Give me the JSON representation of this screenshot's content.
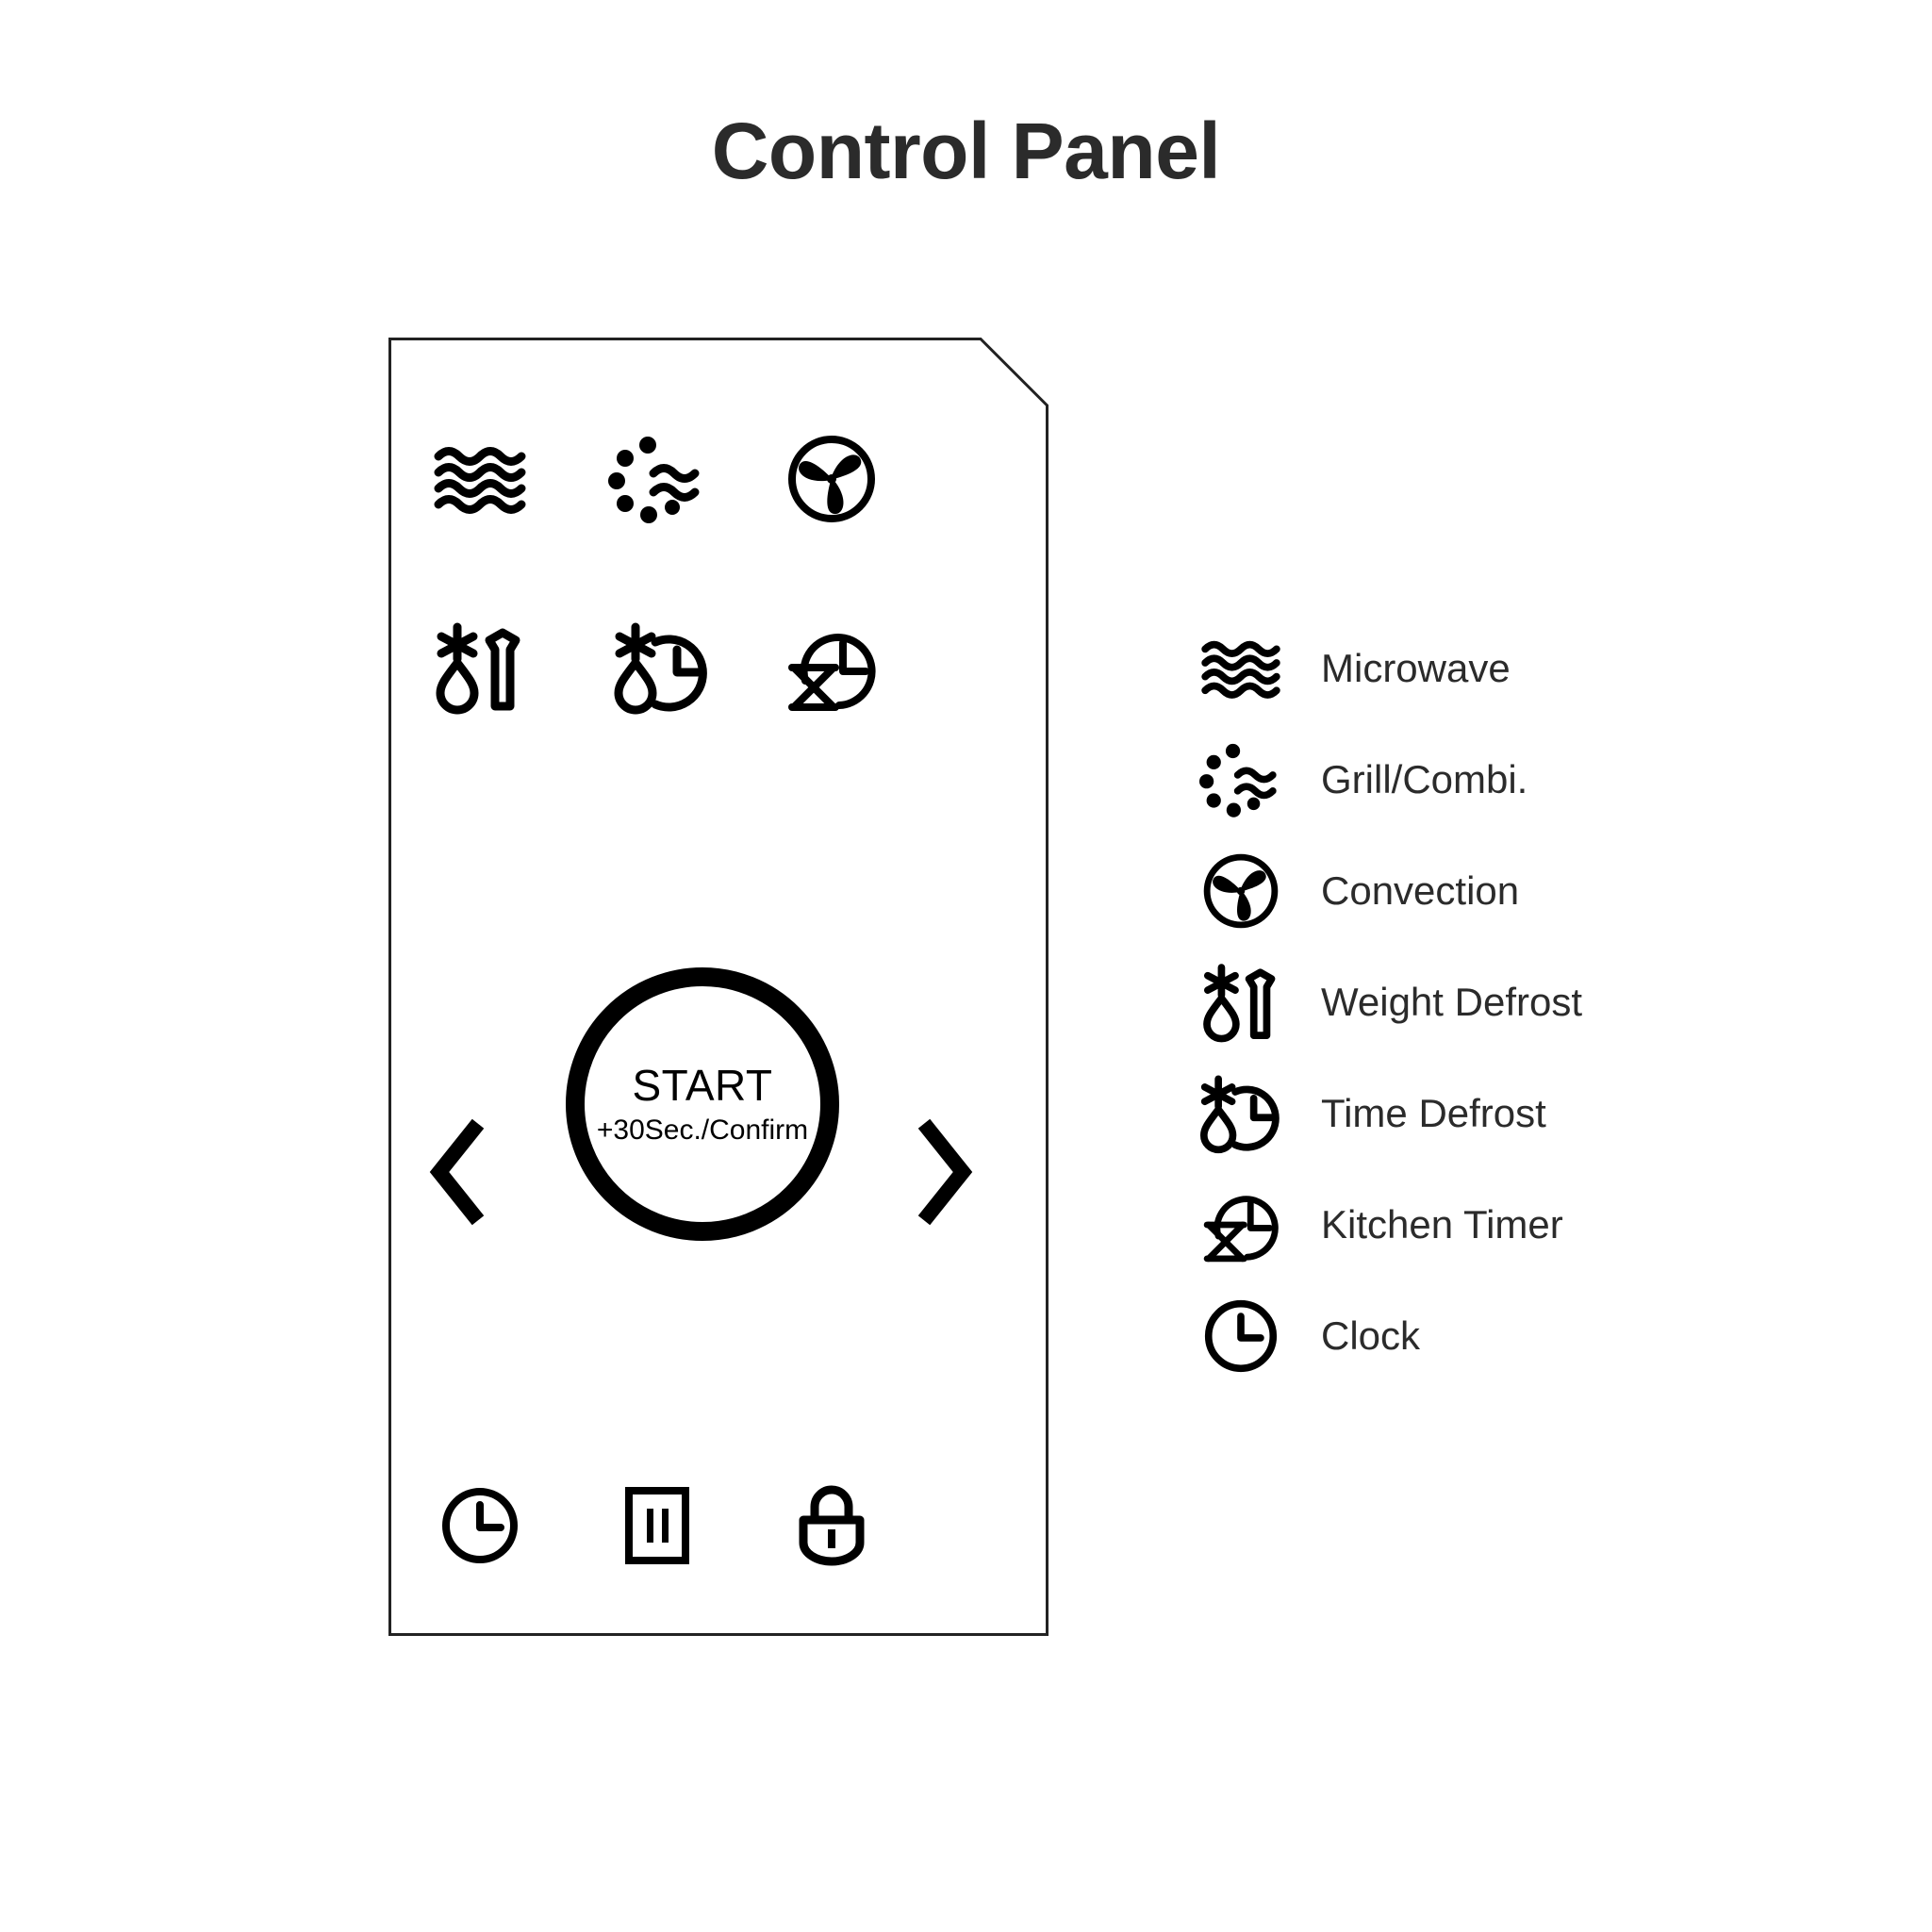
{
  "page": {
    "title": "Control Panel",
    "background_color": "#ffffff",
    "title_color": "#2b2b2b",
    "stroke_color": "#000000"
  },
  "panel": {
    "name": "microwave-control-panel",
    "outline_color": "#222222",
    "corner_cut": "top-right",
    "buttons": [
      {
        "row": 1,
        "col": 1,
        "icon": "microwave-waves-icon",
        "function": "Microwave"
      },
      {
        "row": 1,
        "col": 2,
        "icon": "grill-combi-icon",
        "function": "Grill/Combi."
      },
      {
        "row": 1,
        "col": 3,
        "icon": "convection-fan-icon",
        "function": "Convection"
      },
      {
        "row": 2,
        "col": 1,
        "icon": "weight-defrost-icon",
        "function": "Weight Defrost"
      },
      {
        "row": 2,
        "col": 2,
        "icon": "time-defrost-icon",
        "function": "Time Defrost"
      },
      {
        "row": 2,
        "col": 3,
        "icon": "kitchen-timer-icon",
        "function": "Kitchen Timer"
      }
    ],
    "bottom_buttons": [
      {
        "icon": "clock-icon",
        "function": "Clock"
      },
      {
        "icon": "pause-icon",
        "function": "Pause/Stop"
      },
      {
        "icon": "lock-icon",
        "function": "Child Lock"
      }
    ],
    "nav": {
      "prev_icon": "chevron-left-icon",
      "next_icon": "chevron-right-icon"
    },
    "start_button": {
      "label": "START",
      "sublabel": "+30Sec./Confirm"
    }
  },
  "legend": {
    "items": [
      {
        "icon": "microwave-waves-icon",
        "label": "Microwave"
      },
      {
        "icon": "grill-combi-icon",
        "label": "Grill/Combi."
      },
      {
        "icon": "convection-fan-icon",
        "label": "Convection"
      },
      {
        "icon": "weight-defrost-icon",
        "label": "Weight Defrost"
      },
      {
        "icon": "time-defrost-icon",
        "label": "Time Defrost"
      },
      {
        "icon": "kitchen-timer-icon",
        "label": "Kitchen Timer"
      },
      {
        "icon": "clock-icon",
        "label": "Clock"
      }
    ]
  }
}
